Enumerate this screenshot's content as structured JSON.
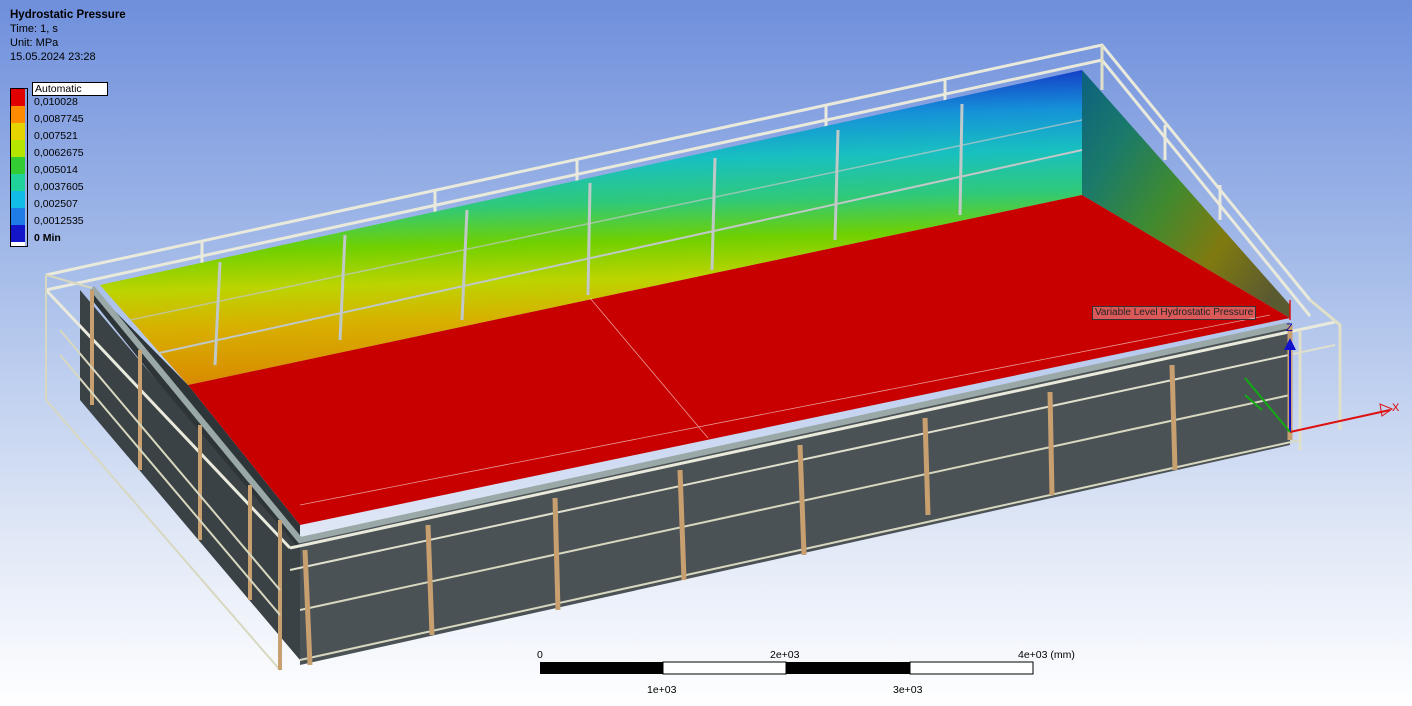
{
  "result": {
    "title": "Hydrostatic Pressure",
    "time": "Time: 1, s",
    "unit": "Unit: MPa",
    "timestamp": "15.05.2024 23:28"
  },
  "legend": {
    "mode": "Automatic",
    "levels": [
      {
        "label": "0,010028",
        "color": "#e00000"
      },
      {
        "label": "0,0087745",
        "color": "#ff8c00"
      },
      {
        "label": "0,007521",
        "color": "#e6d400"
      },
      {
        "label": "0,0062675",
        "color": "#b4e600"
      },
      {
        "label": "0,005014",
        "color": "#33cc33"
      },
      {
        "label": "0,0037605",
        "color": "#1fd39a"
      },
      {
        "label": "0,002507",
        "color": "#11bce6"
      },
      {
        "label": "0,0012535",
        "color": "#1f7be6"
      },
      {
        "label": "0 Min",
        "color": "#1414c8"
      }
    ]
  },
  "scale_bar": {
    "top_labels": [
      "0",
      "2e+03",
      "4e+03 (mm)"
    ],
    "bottom_labels": [
      "1e+03",
      "3e+03"
    ]
  },
  "load_label": "Variable Level Hydrostatic Pressure",
  "triad": {
    "x": "X",
    "z": "Z",
    "x_color": "#dd1111",
    "y_color": "#11aa11",
    "z_color": "#1111cc"
  },
  "colors": {
    "floor_pressure": "#c80000",
    "frame_metal": "#3e4549",
    "rail": "#e8e8d8"
  }
}
